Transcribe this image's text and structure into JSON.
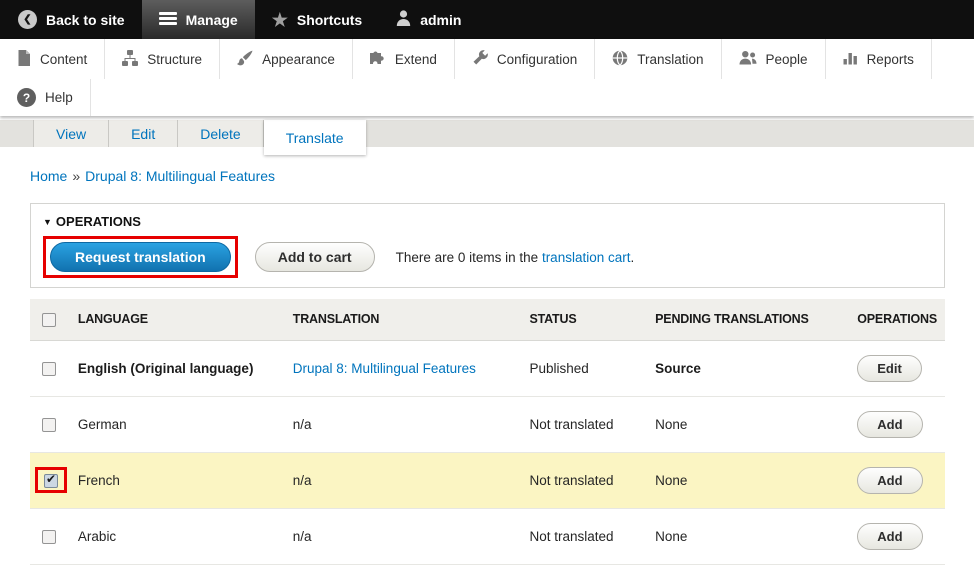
{
  "admin_bar": {
    "items": [
      {
        "label": "Back to site",
        "icon": "back-icon",
        "active": false
      },
      {
        "label": "Manage",
        "icon": "menu-hamburger-icon",
        "active": true
      },
      {
        "label": "Shortcuts",
        "icon": "star-icon",
        "active": false
      },
      {
        "label": "admin",
        "icon": "user-icon",
        "active": false
      }
    ]
  },
  "menu_bar": {
    "items": [
      {
        "label": "Content",
        "icon": "content-icon"
      },
      {
        "label": "Structure",
        "icon": "structure-icon"
      },
      {
        "label": "Appearance",
        "icon": "appearance-icon"
      },
      {
        "label": "Extend",
        "icon": "extend-icon"
      },
      {
        "label": "Configuration",
        "icon": "configuration-icon"
      },
      {
        "label": "Translation",
        "icon": "translation-icon"
      },
      {
        "label": "People",
        "icon": "people-icon"
      },
      {
        "label": "Reports",
        "icon": "reports-icon"
      }
    ],
    "help": {
      "label": "Help",
      "icon": "help-icon"
    }
  },
  "tabs": [
    {
      "label": "View",
      "active": false
    },
    {
      "label": "Edit",
      "active": false
    },
    {
      "label": "Delete",
      "active": false
    },
    {
      "label": "Translate",
      "active": true
    }
  ],
  "breadcrumb": {
    "home": "Home",
    "separator": "»",
    "current": "Drupal 8: Multilingual Features"
  },
  "operations": {
    "collapse_arrow": "▼",
    "legend": "OPERATIONS",
    "request_translation_button": "Request translation",
    "add_to_cart_button": "Add to cart",
    "cart_status_prefix": "There are 0 items in the",
    "cart_link_label": "translation cart",
    "cart_status_suffix": "."
  },
  "table": {
    "headers": {
      "language": "LANGUAGE",
      "translation": "TRANSLATION",
      "status": "STATUS",
      "pending": "PENDING TRANSLATIONS",
      "operations": "OPERATIONS"
    },
    "rows": [
      {
        "language": "English (Original language)",
        "translation": "Drupal 8: Multilingual Features",
        "status": "Published",
        "pending": "Source",
        "operation": "Edit",
        "checked": false,
        "selected": false
      },
      {
        "language": "German",
        "translation": "n/a",
        "status": "Not translated",
        "pending": "None",
        "operation": "Add",
        "checked": false,
        "selected": false
      },
      {
        "language": "French",
        "translation": "n/a",
        "status": "Not translated",
        "pending": "None",
        "operation": "Add",
        "checked": true,
        "selected": true
      },
      {
        "language": "Arabic",
        "translation": "n/a",
        "status": "Not translated",
        "pending": "None",
        "operation": "Add",
        "checked": false,
        "selected": false
      }
    ]
  },
  "colors": {
    "link_blue": "#0074bd",
    "primary_button_blue": "#1c99de",
    "highlight_red": "#e60000",
    "selected_row_yellow": "#fbf5c3",
    "admin_bar_black": "#0f0f0f"
  }
}
